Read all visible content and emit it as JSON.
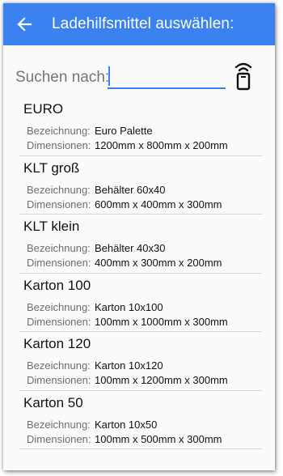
{
  "header": {
    "title": "Ladehilfsmittel auswählen:",
    "back_icon": "arrow-left-icon"
  },
  "search": {
    "label": "Suchen nach:",
    "value": "",
    "placeholder": "",
    "scan_icon": "rfid-reader-icon"
  },
  "field_labels": {
    "designation": "Bezeichnung:",
    "dimensions": "Dimensionen:"
  },
  "items": [
    {
      "name": "EURO",
      "designation": "Euro Palette",
      "dimensions": "1200mm x 800mm x 200mm"
    },
    {
      "name": "KLT groß",
      "designation": "Behälter 60x40",
      "dimensions": "600mm x 400mm x 300mm"
    },
    {
      "name": "KLT klein",
      "designation": "Behälter 40x30",
      "dimensions": "400mm x 300mm x 200mm"
    },
    {
      "name": "Karton 100",
      "designation": "Karton 10x100",
      "dimensions": "100mm x 1000mm x 300mm"
    },
    {
      "name": "Karton 120",
      "designation": "Karton 10x120",
      "dimensions": "100mm x 1200mm x 300mm"
    },
    {
      "name": "Karton 50",
      "designation": "Karton 10x50",
      "dimensions": "100mm x 500mm x 300mm"
    }
  ],
  "colors": {
    "accent": "#3b82f0",
    "background": "#fafafa",
    "divider": "#d6d6d6"
  }
}
